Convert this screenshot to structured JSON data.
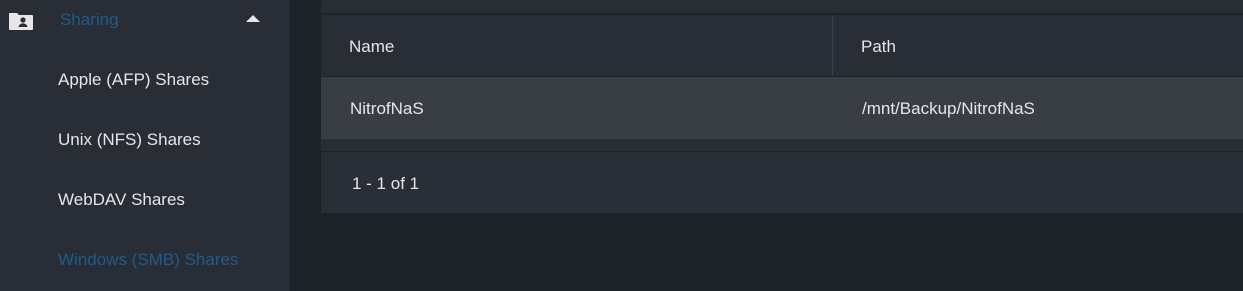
{
  "sidebar": {
    "section": {
      "label": "Sharing",
      "icon": "folder-shared-icon",
      "expanded": true
    },
    "items": [
      {
        "label": "Apple (AFP) Shares",
        "active": false
      },
      {
        "label": "Unix (NFS) Shares",
        "active": false
      },
      {
        "label": "WebDAV Shares",
        "active": false
      },
      {
        "label": "Windows (SMB) Shares",
        "active": true
      }
    ]
  },
  "table": {
    "columns": [
      "Name",
      "Path"
    ],
    "rows": [
      {
        "name": "NitrofNaS",
        "path": "/mnt/Backup/NitrofNaS"
      }
    ],
    "pagination": "1 - 1 of 1"
  },
  "colors": {
    "accent": "#1f5c8c",
    "sidebar_bg": "#282d36",
    "page_bg": "#1e2229",
    "row_bg": "#393e45"
  }
}
